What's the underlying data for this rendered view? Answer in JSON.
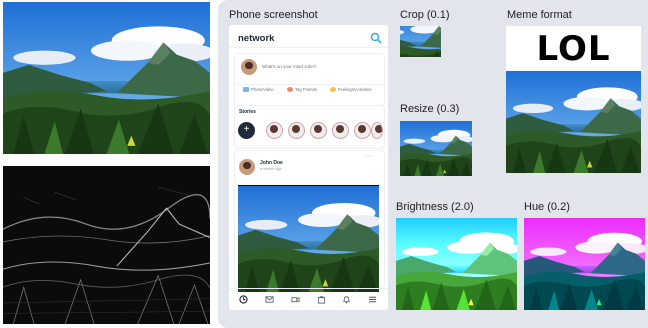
{
  "panel": {
    "phone_label": "Phone screenshot",
    "crop_label": "Crop (0.1)",
    "meme_label": "Meme format",
    "resize_label": "Resize (0.3)",
    "brightness_label": "Brightness (2.0)",
    "hue_label": "Hue (0.2)"
  },
  "meme": {
    "caption": "LOL"
  },
  "phone": {
    "app_title": "network",
    "composer_placeholder": "What's on your mind John?",
    "actions": [
      "Photo/Video",
      "Tag Friends",
      "Feelings/Activities"
    ],
    "stories_title": "Stories",
    "post_author": "John Doe",
    "post_time": "a minute ago",
    "more_dots": "···",
    "nav_icons": [
      "clock-icon",
      "mail-icon",
      "video-icon",
      "bag-icon",
      "bell-icon",
      "menu-icon"
    ]
  },
  "colors": {
    "panel_bg": "#e3e5ec",
    "sky": "#2f7fd8",
    "accent_hue": "#b23fd6"
  }
}
